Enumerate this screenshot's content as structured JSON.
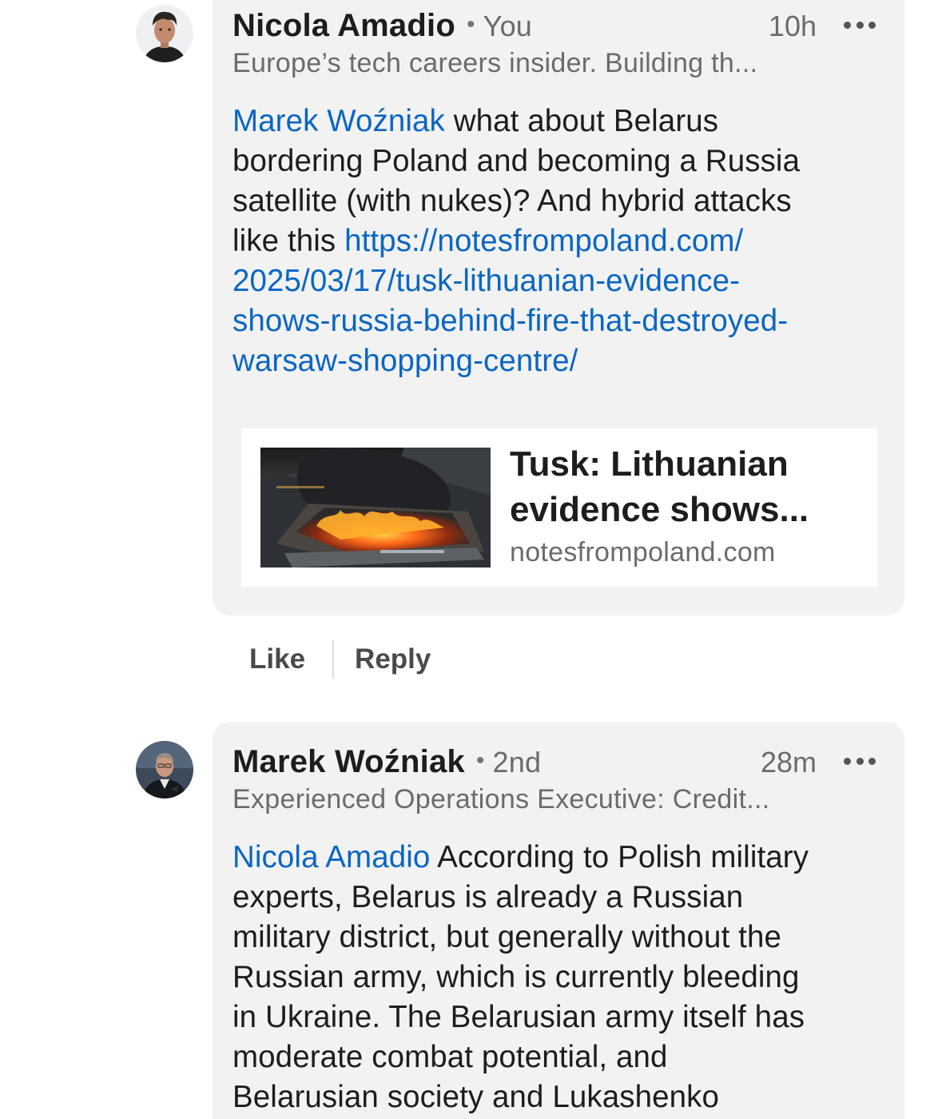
{
  "comment1": {
    "author": "Nicola Amadio",
    "separator": "•",
    "degree": "You",
    "time": "10h",
    "headline": "Europe’s tech careers insider. Building th...",
    "mention": "Marek Woźniak",
    "text_lines": [
      " what about Belarus",
      "bordering Poland and becoming a Russia",
      "satellite (with nukes)? And hybrid attacks",
      "like this "
    ],
    "link_lines": [
      "https://notesfrompoland.com/",
      "2025/03/17/tusk-lithuanian-evidence-",
      "shows-russia-behind-fire-that-destroyed-",
      "warsaw-shopping-centre/"
    ],
    "card": {
      "title_lines": [
        "Tusk: Lithuanian",
        "evidence shows..."
      ],
      "domain": "notesfrompoland.com"
    },
    "actions": {
      "like": "Like",
      "reply": "Reply"
    },
    "more_icon": "ellipsis-icon"
  },
  "comment2": {
    "author": "Marek Woźniak",
    "separator": "•",
    "degree": "2nd",
    "time": "28m",
    "headline": "Experienced Operations Executive: Credit...",
    "mention": "Nicola Amadio",
    "text_lines": [
      " According to Polish military",
      "experts, Belarus is already a Russian",
      "military district, but generally without the",
      "Russian army, which is currently bleeding",
      "in Ukraine. The Belarusian army itself has",
      "moderate combat potential, and",
      "Belarusian society and Lukashenko"
    ],
    "more_icon": "ellipsis-icon"
  },
  "colors": {
    "link": "#0a66c2",
    "bubble": "#f2f2f2",
    "text": "#1d1d1d",
    "muted": "#6b6b6b"
  }
}
